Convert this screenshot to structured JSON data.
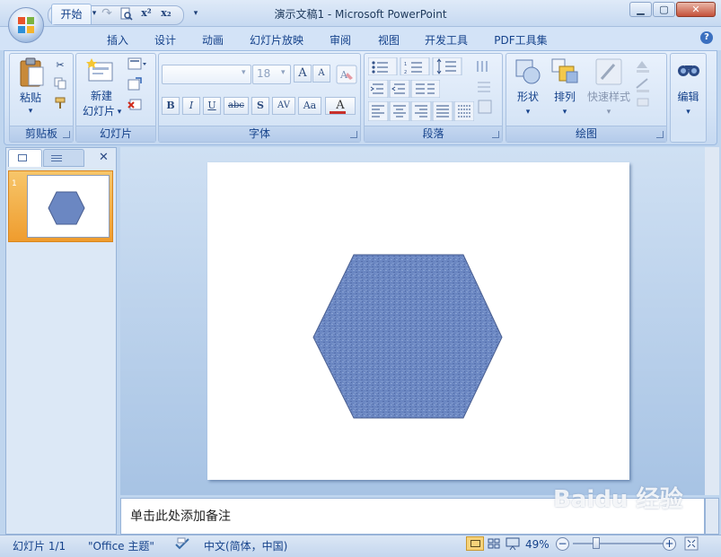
{
  "window": {
    "title": "演示文稿1 - Microsoft PowerPoint",
    "minimize": "▁",
    "restore": "▢",
    "close": "✕"
  },
  "quick_access": {
    "save_icon": "save-icon",
    "undo_icon": "undo-icon",
    "redo_icon": "redo-icon",
    "print_preview_icon": "print-preview-icon",
    "superscript": "x²",
    "subscript": "x₂",
    "customize": "▾"
  },
  "tabs": [
    {
      "label": "开始",
      "active": true
    },
    {
      "label": "插入"
    },
    {
      "label": "设计"
    },
    {
      "label": "动画"
    },
    {
      "label": "幻灯片放映"
    },
    {
      "label": "审阅"
    },
    {
      "label": "视图"
    },
    {
      "label": "开发工具"
    },
    {
      "label": "PDF工具集"
    }
  ],
  "help": "?",
  "ribbon": {
    "clipboard": {
      "label": "剪贴板",
      "paste": "粘贴",
      "paste_arrow": "▾"
    },
    "slides": {
      "label": "幻灯片",
      "new_slide_line1": "新建",
      "new_slide_line2": "幻灯片",
      "arrow": "▾"
    },
    "font": {
      "label": "字体",
      "font_name": "",
      "font_size": "18",
      "grow": "A",
      "shrink": "A",
      "bold": "B",
      "italic": "I",
      "underline": "U",
      "strike": "abc",
      "shadow": "S",
      "spacing": "AV",
      "case": "Aa",
      "color": "A"
    },
    "paragraph": {
      "label": "段落"
    },
    "drawing": {
      "label": "绘图",
      "shapes": "形状",
      "arrange": "排列",
      "quick_styles": "快速样式",
      "arrow": "▾"
    },
    "editing": {
      "label": "编辑",
      "arrow": "▾"
    }
  },
  "panel": {
    "close": "✕",
    "slide_number": "1"
  },
  "notes": {
    "placeholder": "单击此处添加备注"
  },
  "status": {
    "slide": "幻灯片 1/1",
    "theme": "\"Office 主题\"",
    "language": "中文(简体，中国)",
    "zoom": "49%",
    "zoom_minus": "−",
    "zoom_plus": "+",
    "zoom_level": 0.49
  },
  "watermark": {
    "text": "Baidu 经验"
  },
  "colors": {
    "hexagon_fill": "#6b87c2",
    "hexagon_stroke": "#4a5f91",
    "thumb_accent": "#f3a73c"
  }
}
